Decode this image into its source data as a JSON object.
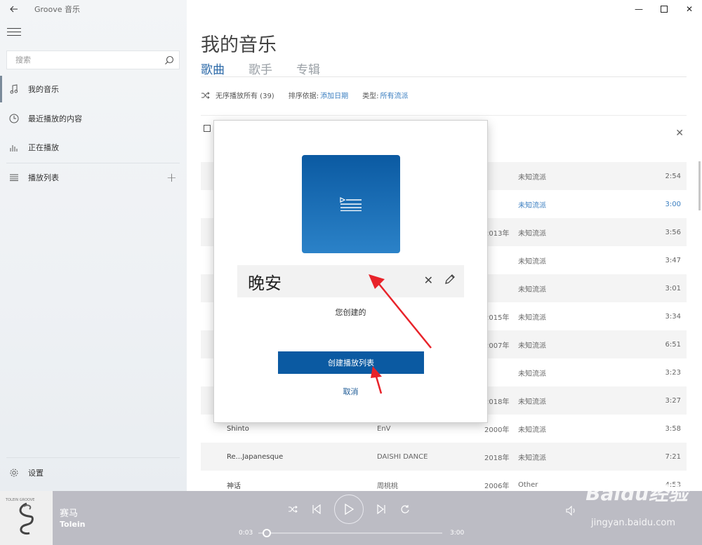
{
  "app": {
    "title": "Groove 音乐"
  },
  "sidebar": {
    "search_placeholder": "搜索",
    "items": [
      {
        "label": "我的音乐",
        "icon": "music-note-icon",
        "active": true
      },
      {
        "label": "最近播放的内容",
        "icon": "clock-icon"
      },
      {
        "label": "正在播放",
        "icon": "equalizer-icon"
      },
      {
        "label": "播放列表",
        "icon": "list-icon"
      }
    ],
    "settings_label": "设置"
  },
  "main": {
    "title": "我的音乐",
    "tabs": [
      "歌曲",
      "歌手",
      "专辑"
    ],
    "shuffle_label": "无序播放所有 (39)",
    "sort_label": "排序依据:",
    "sort_value": "添加日期",
    "type_label": "类型:",
    "type_value": "所有流派",
    "songs": [
      {
        "title": "",
        "artist": "",
        "year": "",
        "genre": "未知流派",
        "duration": "2:54"
      },
      {
        "title": "",
        "artist": "",
        "year": "",
        "genre": "未知流派",
        "duration": "3:00",
        "playing": true
      },
      {
        "title": "",
        "artist": "",
        "year": "2013年",
        "genre": "未知流派",
        "duration": "3:56"
      },
      {
        "title": "",
        "artist": "",
        "year": "",
        "genre": "未知流派",
        "duration": "3:47"
      },
      {
        "title": "",
        "artist": "",
        "year": "",
        "genre": "未知流派",
        "duration": "3:01"
      },
      {
        "title": "",
        "artist": "",
        "year": "2015年",
        "genre": "未知流派",
        "duration": "3:34"
      },
      {
        "title": "",
        "artist": "",
        "year": "2007年",
        "genre": "未知流派",
        "duration": "6:51"
      },
      {
        "title": "",
        "artist": "",
        "year": "",
        "genre": "未知流派",
        "duration": "3:23"
      },
      {
        "title": "",
        "artist": "",
        "year": "2018年",
        "genre": "未知流派",
        "duration": "3:27"
      },
      {
        "title": "Shinto",
        "artist": "EnV",
        "year": "2000年",
        "genre": "未知流派",
        "duration": "3:58"
      },
      {
        "title": "Re...Japanesque",
        "artist": "DAISHI DANCE",
        "year": "2018年",
        "genre": "未知流派",
        "duration": "7:21"
      },
      {
        "title": "神话",
        "artist": "周桃桃",
        "year": "2006年",
        "genre": "Other",
        "duration": "4:53"
      }
    ]
  },
  "dialog": {
    "name_value": "晚安",
    "creator_text": "您创建的",
    "create_button": "创建播放列表",
    "cancel_link": "取消"
  },
  "player": {
    "track_title": "赛马",
    "track_artist": "Tolein",
    "album_tiny_text": "TOLEIN GROOVE",
    "time_current": "0:03",
    "time_total": "3:00",
    "progress": 0.02
  },
  "watermark": {
    "main": "Baidu经验",
    "sub": "jingyan.baidu.com"
  },
  "colors": {
    "accent": "#0b5aa2",
    "link": "#3a7ec0",
    "player_bg": "#bcbcc4"
  }
}
